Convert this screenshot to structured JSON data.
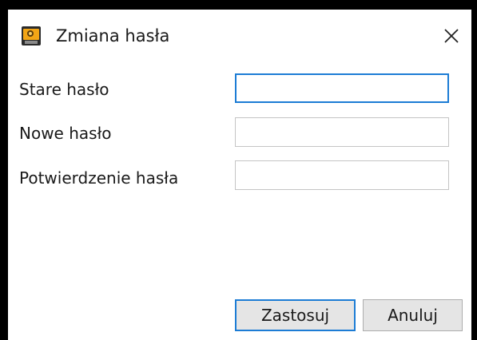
{
  "window": {
    "title": "Zmiana hasła",
    "app_icon": "password-app-icon",
    "close_icon": "close-icon"
  },
  "form": {
    "fields": [
      {
        "label": "Stare hasło",
        "value": "",
        "focused": true
      },
      {
        "label": "Nowe hasło",
        "value": "",
        "focused": false
      },
      {
        "label": "Potwierdzenie hasła",
        "value": "",
        "focused": false
      }
    ]
  },
  "buttons": {
    "apply_label": "Zastosuj",
    "cancel_label": "Anuluj"
  },
  "colors": {
    "accent": "#1c7cd5",
    "button_face": "#e5e5e5",
    "input_border": "#c4c4c4"
  }
}
